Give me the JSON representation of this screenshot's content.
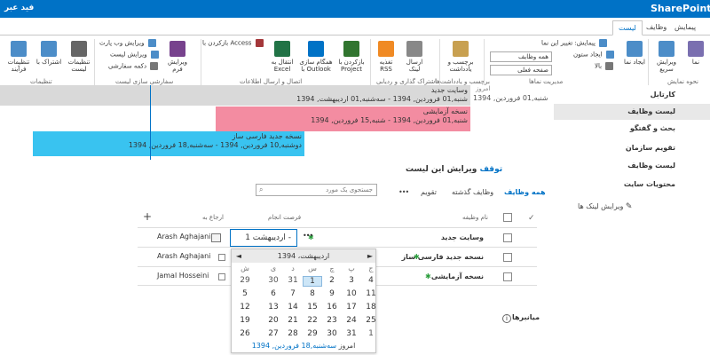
{
  "topbar": {
    "brand": "SharePoint",
    "user": "فید عبر"
  },
  "tabs": [
    {
      "label": "پیمایش"
    },
    {
      "label": "وظایف"
    },
    {
      "label": "لیست"
    }
  ],
  "ribbon": {
    "big_buttons": [
      {
        "label": "نما",
        "icon": "view-icon",
        "color": "#7a6fb0"
      },
      {
        "label": "ویرایش سریع",
        "icon": "quick-edit-icon",
        "color": "#4c8dc8"
      },
      {
        "label": "ایجاد نما",
        "icon": "create-view-icon",
        "color": "#4c8dc8"
      },
      {
        "label": "برچسب و یادداشت",
        "icon": "tags-icon",
        "color": "#c8a050"
      },
      {
        "label": "ارسال لینک",
        "icon": "email-link-icon",
        "color": "#888888"
      },
      {
        "label": "تغذیه RSS",
        "icon": "rss-icon",
        "color": "#f08a24"
      },
      {
        "label": "بازکردن با Project",
        "icon": "project-icon",
        "color": "#31752f"
      },
      {
        "label": "همگام سازی با Outlook",
        "icon": "outlook-icon",
        "color": "#0072c6"
      },
      {
        "label": "انتقال به Excel",
        "icon": "excel-icon",
        "color": "#217346"
      },
      {
        "label": "ویرایش فرم",
        "icon": "infopath-icon",
        "color": "#77428d"
      },
      {
        "label": "تنظیمات لیست",
        "icon": "list-settings-icon",
        "color": "#666666"
      },
      {
        "label": "اشتراک با",
        "icon": "share-icon",
        "color": "#4c8dc8"
      },
      {
        "label": "تنظیمات فرآیند",
        "icon": "workflow-settings-icon",
        "color": "#4c8dc8"
      }
    ],
    "small_buttons": {
      "modify_view": "تغییر این نما",
      "navigate": "پیمایش:",
      "create_column": "ایجاد ستون",
      "up": "بالا",
      "current_view_select": "همه وظایف",
      "current_page": "صفحه فعلی",
      "open_with_access": "بازکردن با Access",
      "edit_webpart": "ویرایش وب پارت",
      "edit_list": "ویرایش لیست",
      "new_quick_step": "دکمه سفارشی"
    },
    "groups": [
      {
        "label": "نحوه نمایش"
      },
      {
        "label": "مدیریت نماها"
      },
      {
        "label": "برچسب و یادداشت‌ها"
      },
      {
        "label": "اشتراک گذاری و ردیابی"
      },
      {
        "label": "اتصال و ارسال اطلاعات"
      },
      {
        "label": "سفارشی سازی لیست"
      },
      {
        "label": "تنظیمات"
      }
    ]
  },
  "timeline": {
    "header_label": "امروز",
    "bars": [
      {
        "title": "وسایت جدید",
        "dates": "شنبه,01 فروردین, 1394 - سه‌شنبه,01 اردیبهشت, 1394",
        "color": "#d9d9d9"
      },
      {
        "title": "نسخه آزمایشی",
        "dates": "شنبه,01 فروردین, 1394 - شنبه,15 فروردین, 1394",
        "color": "#f38ca1"
      },
      {
        "title": "نسخه جدید فارسی ساز",
        "dates": "دوشنبه,10 فروردین, 1394 - سه‌شنبه,18 فروردین, 1394",
        "color": "#39c3f0"
      }
    ],
    "outside_label": "شنبه,01 فروردین, 1394"
  },
  "quicknav": {
    "items": [
      {
        "label": "کارتابل"
      },
      {
        "label": "لیست وظایف"
      },
      {
        "label": "بحث و گفتگو"
      },
      {
        "label": "تقویم سازمان"
      },
      {
        "label": "لیست وظایف"
      },
      {
        "label": "محتویات سایت"
      }
    ],
    "edit_links": "ویرایش لینک ها"
  },
  "page": {
    "title_highlight": "توقف",
    "title_rest": " ویرایش این لیست"
  },
  "views": {
    "all_tasks": "همه وظایف",
    "late_tasks": "وظایف گذشته",
    "calendar": "تقویم",
    "more": "•••",
    "search_placeholder": "جستجوی یک مورد"
  },
  "table": {
    "headers": {
      "check": "✓",
      "task_name": "نام وظیفه",
      "due_date": "فرصت انجام",
      "assigned_to": "ارجاع به"
    },
    "rows": [
      {
        "name": "وسایت جدید",
        "due": "اردیبهشت 1 -",
        "assignee": "Arash Aghajani"
      },
      {
        "name": "نسخه جدید فارسی ساز",
        "due": "",
        "assignee": "Arash Aghajani"
      },
      {
        "name": "نسخه آزمایشی",
        "due": "",
        "assignee": "Jamal Hosseini"
      }
    ],
    "ellipsis": "•••",
    "add": "+"
  },
  "calendar": {
    "month_label": "اردیبهشت، 1394",
    "prev": "◄",
    "next": "►",
    "dow": [
      "ج",
      "پ",
      "چ",
      "س",
      "د",
      "ی",
      "ش"
    ],
    "weeks": [
      [
        "4",
        "3",
        "2",
        "1",
        "31",
        "30",
        "29"
      ],
      [
        "11",
        "10",
        "9",
        "8",
        "7",
        "6",
        "5"
      ],
      [
        "18",
        "17",
        "16",
        "15",
        "14",
        "13",
        "12"
      ],
      [
        "25",
        "24",
        "23",
        "22",
        "21",
        "20",
        "19"
      ],
      [
        "1",
        "31",
        "30",
        "29",
        "28",
        "27",
        "26"
      ]
    ],
    "today_prefix": "امروز ",
    "today_link": "سه‌شنبه,18 فروردین, 1394"
  },
  "footer": {
    "related": "میانبرها"
  }
}
